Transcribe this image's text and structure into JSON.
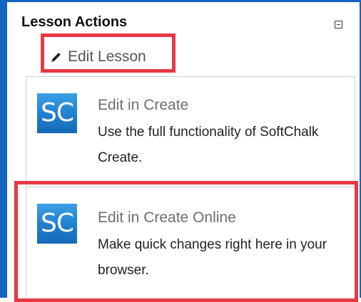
{
  "panel": {
    "title": "Lesson Actions",
    "collapse_icon": "collapse-minus-icon"
  },
  "edit_lesson": {
    "label": "Edit Lesson",
    "icon": "pencil-icon"
  },
  "options": [
    {
      "logo_text": "SC",
      "title": "Edit in Create",
      "description": "Use the full functionality of SoftChalk Create."
    },
    {
      "logo_text": "SC",
      "title": "Edit in Create Online",
      "description": "Make quick changes right here in your browser."
    }
  ],
  "colors": {
    "frame_blue": "#1565c0",
    "highlight_red": "#e53945",
    "logo_blue": "#1f7fcf"
  }
}
